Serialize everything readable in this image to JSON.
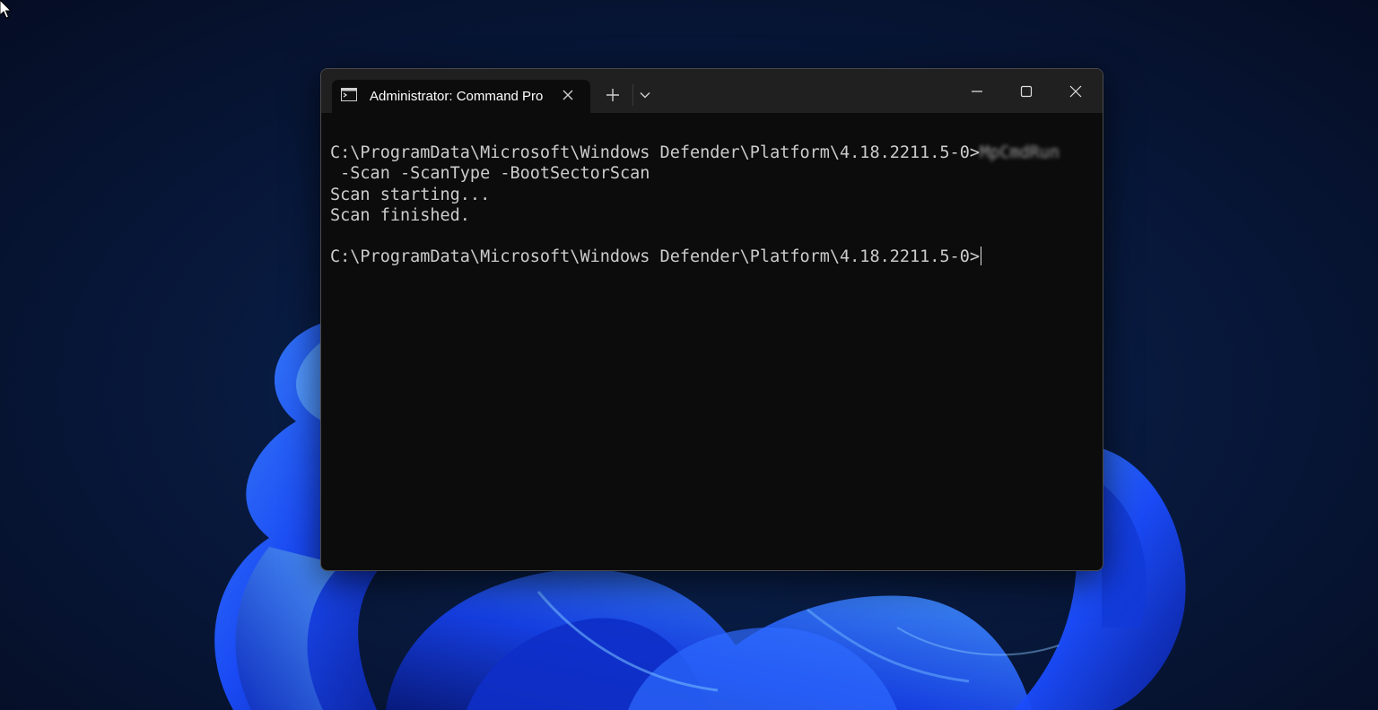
{
  "window": {
    "tab_title": "Administrator: Command Pro",
    "tab_icon": "command-prompt-icon",
    "controls": {
      "new_tab": "plus-icon",
      "dropdown": "chevron-down-icon",
      "minimize": "minimize-icon",
      "maximize": "maximize-icon",
      "close": "close-icon"
    }
  },
  "terminal": {
    "lines": [
      {
        "prompt": "C:\\ProgramData\\Microsoft\\Windows Defender\\Platform\\4.18.2211.5-0>",
        "command": "MpCmdRun"
      },
      {
        "text": " -Scan -ScanType -BootSectorScan"
      },
      {
        "text": "Scan starting..."
      },
      {
        "text": "Scan finished."
      },
      {
        "text": ""
      },
      {
        "prompt": "C:\\ProgramData\\Microsoft\\Windows Defender\\Platform\\4.18.2211.5-0>"
      }
    ]
  },
  "colors": {
    "terminal_bg": "#0c0c0c",
    "terminal_text": "#cccccc",
    "titlebar_bg": "#202020",
    "wallpaper_accent": "#1e5bff"
  }
}
